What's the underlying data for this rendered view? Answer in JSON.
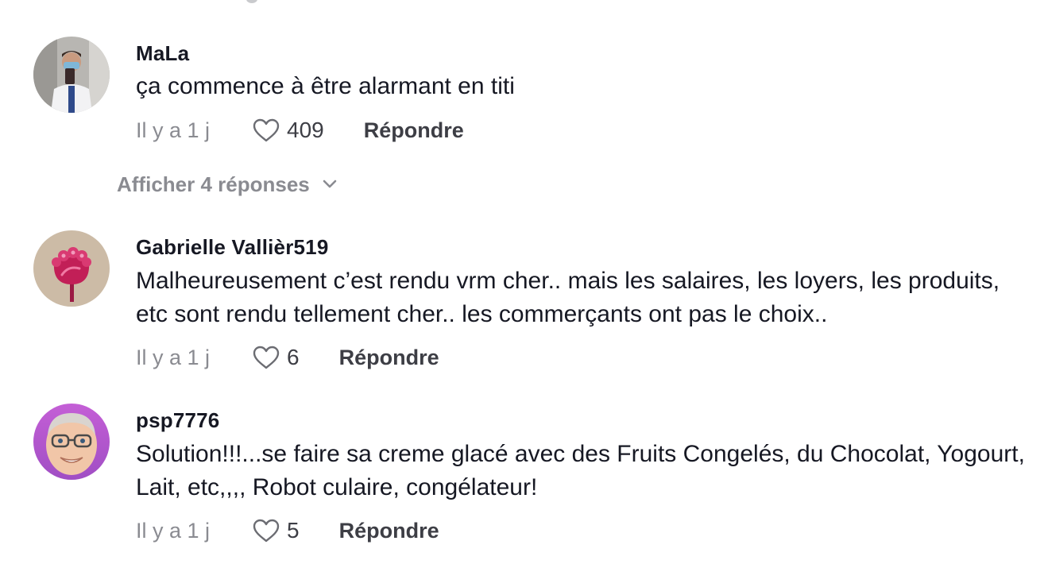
{
  "comments": [
    {
      "username": "MaLa",
      "text": "ça commence à être alarmant en titi",
      "time": "Il y a 1 j",
      "likes": "409",
      "reply_label": "Répondre",
      "avatar_icon": "person-photo-avatar"
    },
    {
      "username": "Gabrielle Vallièr519",
      "text": "Malheureusement c’est rendu vrm cher.. mais les salaires, les loyers, les produits, etc sont rendu tellement cher.. les commerçants ont pas le choix..",
      "time": "Il y a 1 j",
      "likes": "6",
      "reply_label": "Répondre",
      "avatar_icon": "raspberry-flower-avatar"
    },
    {
      "username": "psp7776",
      "text": "Solution!!!...se faire sa creme glacé avec des Fruits Congelés, du Chocolat, Yogourt, Lait, etc,,,, Robot culaire, congélateur!",
      "time": "Il y a 1 j",
      "likes": "5",
      "reply_label": "Répondre",
      "avatar_icon": "memoji-glasses-avatar"
    }
  ],
  "view_replies": {
    "label": "Afficher 4 réponses",
    "icon": "chevron-down-icon"
  },
  "icons": {
    "like": "heart-outline-icon"
  },
  "colors": {
    "primary_text": "#161823",
    "secondary_text": "#8a8b91",
    "action_text": "#3d3e45",
    "background": "#ffffff"
  }
}
